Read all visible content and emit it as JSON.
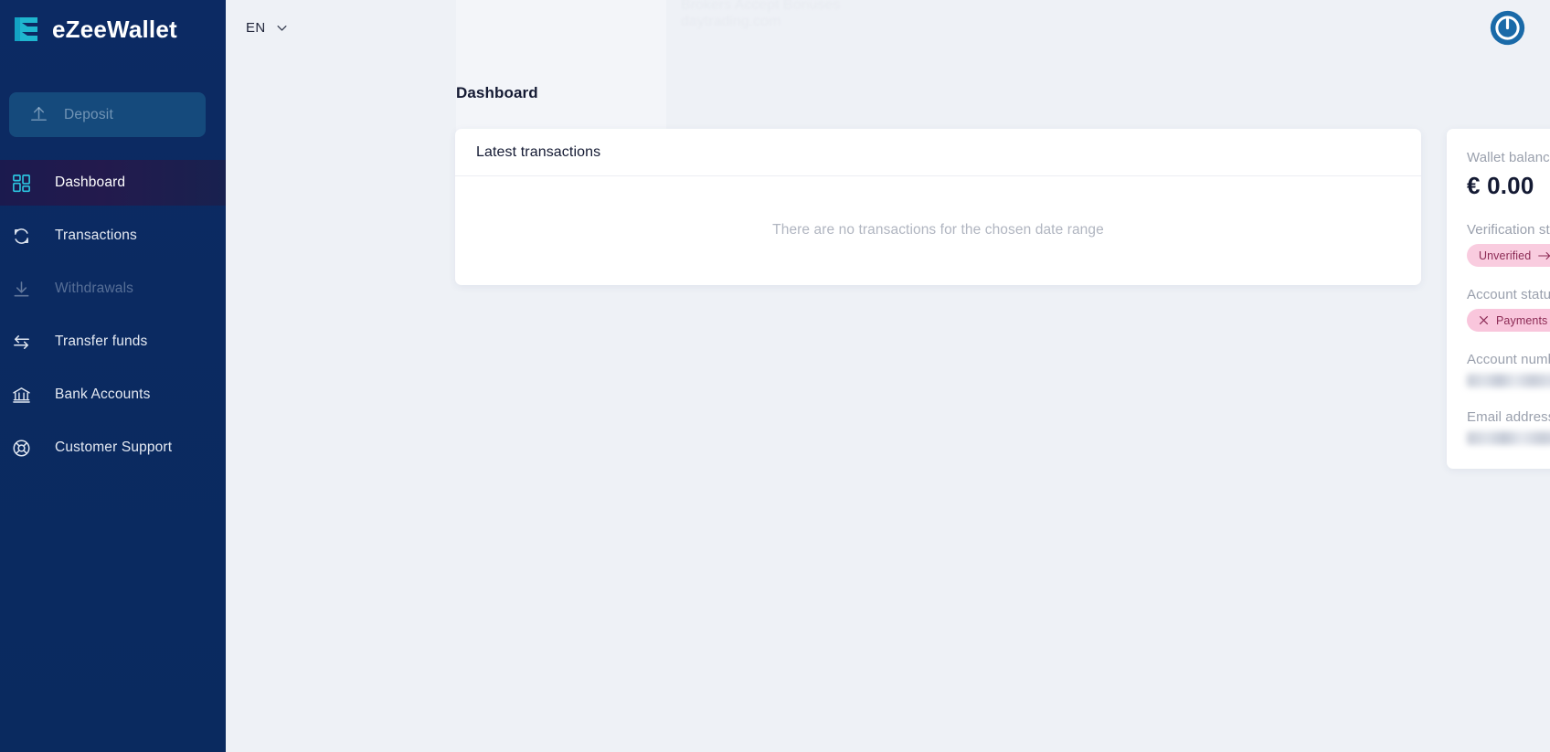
{
  "brand": {
    "name": "eZeeWallet",
    "logo_icon": "ezeewallet-e-logo",
    "accent": "#1fb6cf",
    "sidebar_bg": "#0b2a61"
  },
  "sidebar": {
    "deposit": {
      "label": "Deposit",
      "icon": "upload-arrow-icon",
      "disabled": true
    },
    "items": [
      {
        "label": "Dashboard",
        "icon": "grid-dashboard-icon",
        "active": true,
        "disabled": false
      },
      {
        "label": "Transactions",
        "icon": "refresh-cycle-icon",
        "active": false,
        "disabled": false
      },
      {
        "label": "Withdrawals",
        "icon": "download-arrow-icon",
        "active": false,
        "disabled": true
      },
      {
        "label": "Transfer funds",
        "icon": "transfer-arrows-icon",
        "active": false,
        "disabled": false
      },
      {
        "label": "Bank Accounts",
        "icon": "bank-building-icon",
        "active": false,
        "disabled": false
      },
      {
        "label": "Customer Support",
        "icon": "lifebuoy-icon",
        "active": false,
        "disabled": false
      }
    ]
  },
  "topbar": {
    "language": {
      "value": "EN",
      "chevron_icon": "chevron-down-icon"
    },
    "logout": {
      "icon": "power-icon",
      "color": "#1a6aa8"
    }
  },
  "main": {
    "page_title": "Dashboard",
    "transactions_card": {
      "title": "Latest transactions",
      "empty_message": "There are no transactions for the chosen date range"
    }
  },
  "account_panel": {
    "wallet_balance_label": "Wallet balance",
    "wallet_balance_value": "€ 0.00",
    "verification_status_label": "Verification status",
    "verification_badge": {
      "text": "Unverified",
      "icon": "arrow-right-icon",
      "bg": "#f9ccdf",
      "fg": "#8c2b55"
    },
    "account_status_label": "Account status",
    "account_status_badge": {
      "text": "Payments suspended",
      "icon": "x-close-icon",
      "bg": "#f9c6dc",
      "fg": "#8c2b55"
    },
    "account_number_label": "Account number",
    "account_number_value": "",
    "email_label": "Email address",
    "email_value": ""
  },
  "ghost_overlay": {
    "line1": "Brokers Accept Bonuses",
    "line2": "daytrading.com"
  }
}
